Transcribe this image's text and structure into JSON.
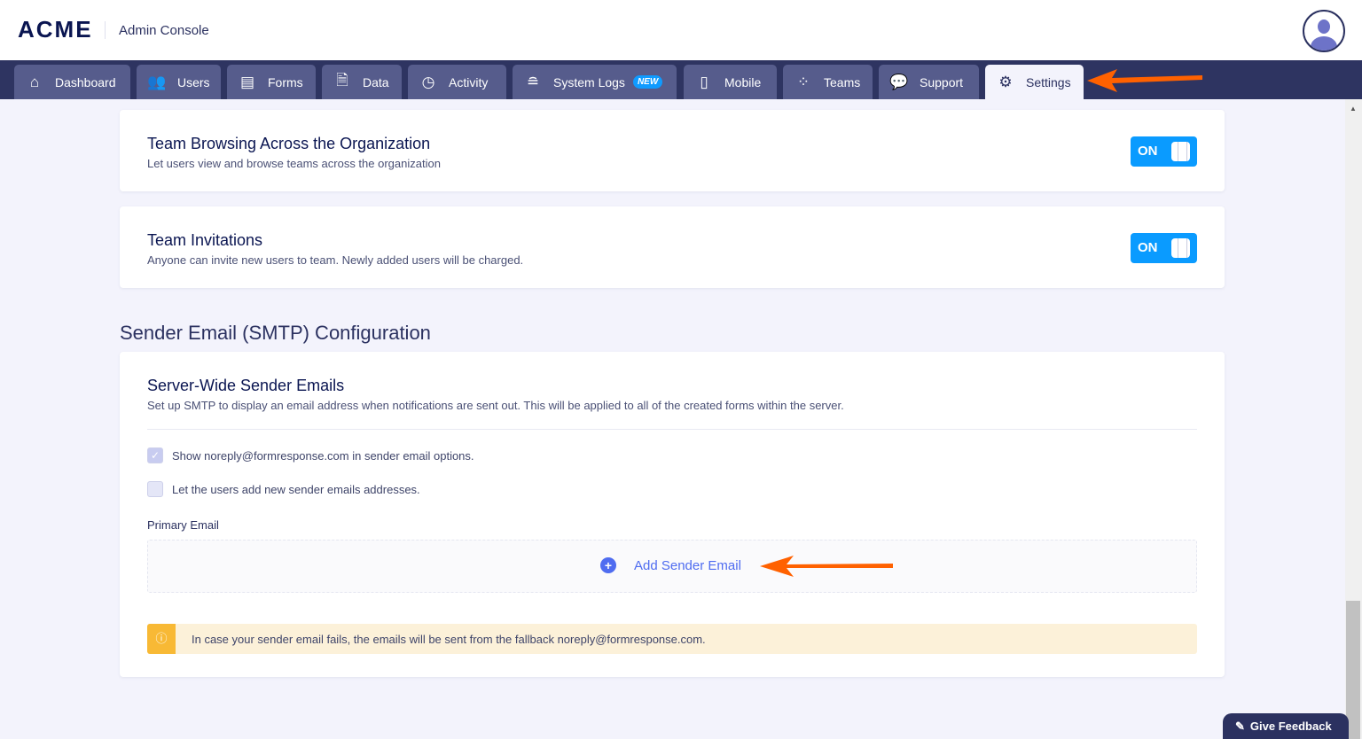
{
  "header": {
    "logo": "ACME",
    "title": "Admin Console"
  },
  "nav": {
    "tabs": [
      {
        "label": "Dashboard",
        "icon": "home-icon"
      },
      {
        "label": "Users",
        "icon": "users-icon"
      },
      {
        "label": "Forms",
        "icon": "forms-icon"
      },
      {
        "label": "Data",
        "icon": "data-icon"
      },
      {
        "label": "Activity",
        "icon": "clock-icon"
      },
      {
        "label": "System Logs",
        "icon": "database-icon",
        "badge": "NEW"
      },
      {
        "label": "Mobile",
        "icon": "mobile-icon"
      },
      {
        "label": "Teams",
        "icon": "teams-icon"
      },
      {
        "label": "Support",
        "icon": "chat-icon"
      },
      {
        "label": "Settings",
        "icon": "gear-icon",
        "active": true
      }
    ]
  },
  "settings": [
    {
      "title": "Team Browsing Across the Organization",
      "desc": "Let users view and browse teams across the organization",
      "toggle": "ON"
    },
    {
      "title": "Team Invitations",
      "desc": "Anyone can invite new users to team. Newly added users will be charged.",
      "toggle": "ON"
    }
  ],
  "smtp": {
    "section_title": "Sender Email (SMTP) Configuration",
    "card_title": "Server-Wide Sender Emails",
    "card_desc": "Set up SMTP to display an email address when notifications are sent out. This will be applied to all of the created forms within the server.",
    "checkboxes": [
      {
        "label": "Show noreply@formresponse.com in sender email options.",
        "checked": true
      },
      {
        "label": "Let the users add new sender emails addresses.",
        "checked": false
      }
    ],
    "primary_label": "Primary Email",
    "add_label": "Add Sender Email",
    "alert": "In case your sender email fails, the emails will be sent from the fallback noreply@formresponse.com."
  },
  "feedback": "Give Feedback",
  "colors": {
    "nav": "#2e3461",
    "tab": "#565c8c",
    "toggle": "#0a9bff",
    "accent": "#4f6cf0",
    "annotation_arrow": "#ff6100"
  }
}
